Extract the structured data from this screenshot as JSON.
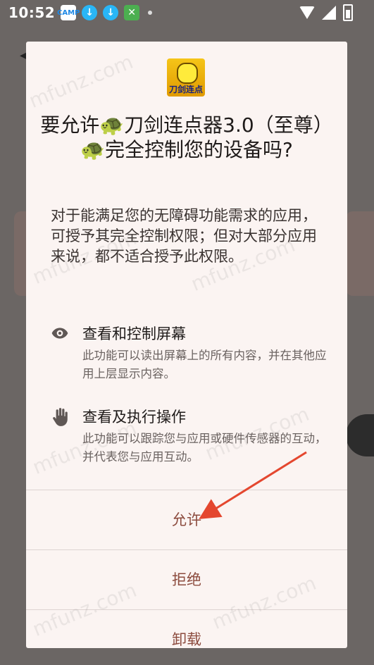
{
  "status_bar": {
    "time": "10:52",
    "app_icon_label": "CAMP"
  },
  "dialog": {
    "app_icon_text": "刀剑连点",
    "title": "要允许🐢刀剑连点器3.0（至尊）🐢完全控制您的设备吗?",
    "description": "对于能满足您的无障碍功能需求的应用，可授予其完全控制权限；但对大部分应用来说，都不适合授予此权限。",
    "permissions": [
      {
        "icon": "eye-icon",
        "title": "查看和控制屏幕",
        "description": "此功能可以读出屏幕上的所有内容，并在其他应用上层显示内容。"
      },
      {
        "icon": "hand-icon",
        "title": "查看及执行操作",
        "description": "此功能可以跟踪您与应用或硬件传感器的互动，并代表您与应用互动。"
      }
    ],
    "buttons": {
      "allow": "允许",
      "deny": "拒绝",
      "uninstall": "卸载"
    }
  },
  "watermark": "mfunz.com",
  "colors": {
    "button_text": "#8c4b3e",
    "dialog_bg": "#fbf4f2",
    "arrow": "#e4472f"
  }
}
